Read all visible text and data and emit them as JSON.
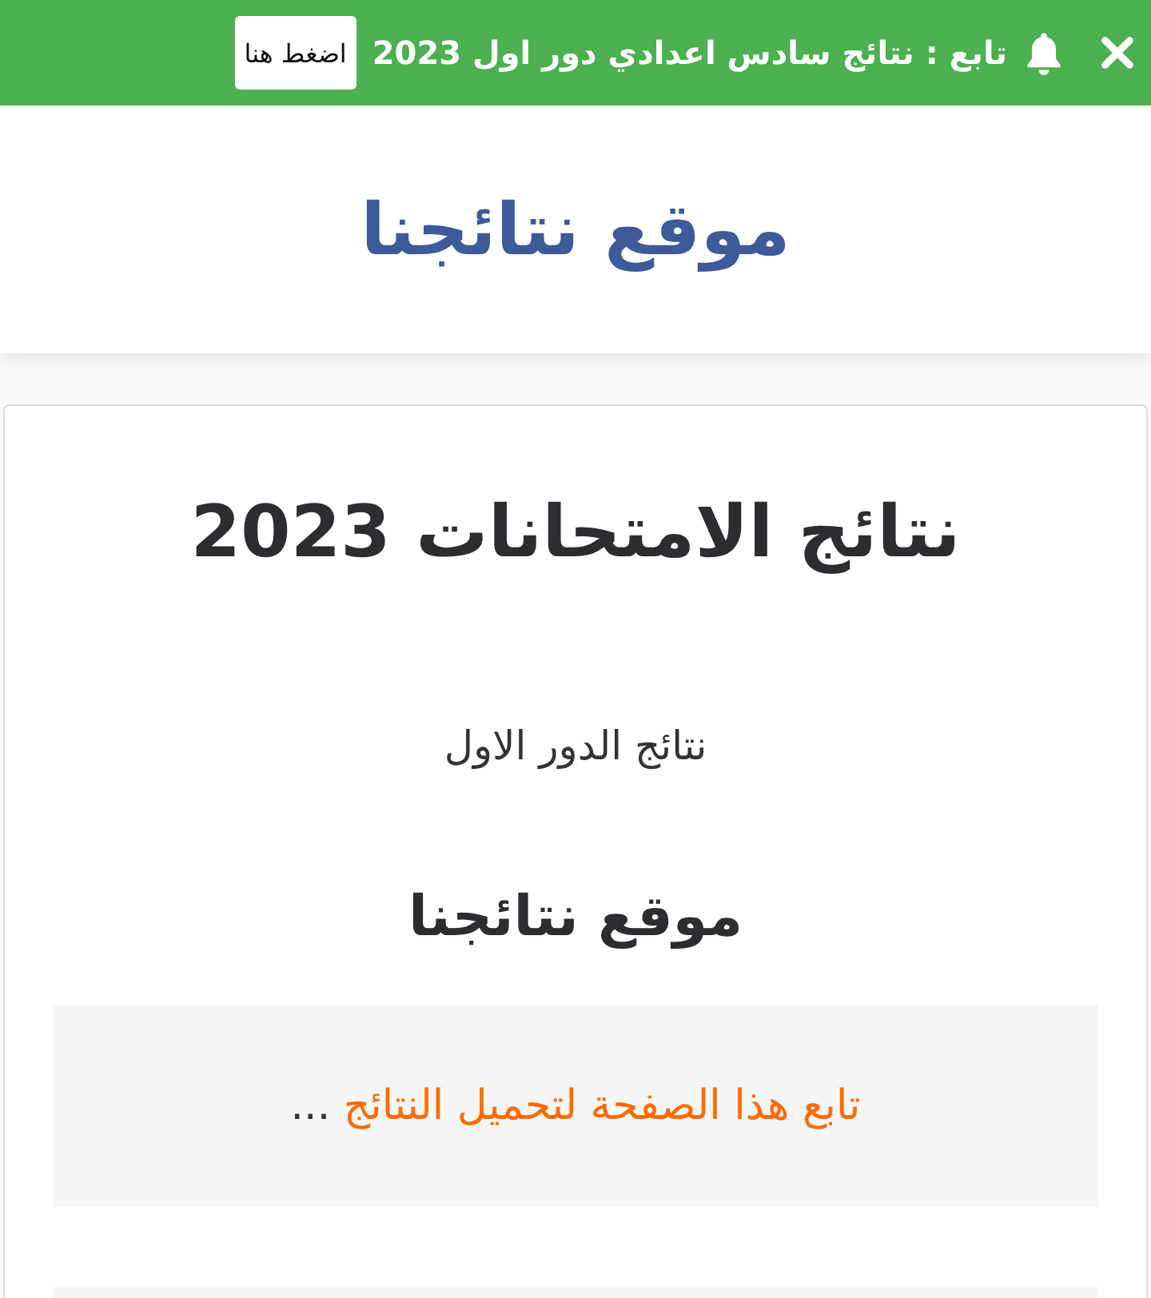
{
  "notification_bar": {
    "message": "تابع : نتائج سادس اعدادي دور اول 2023",
    "button": "اضغط هنا"
  },
  "header": {
    "site_title": "موقع نتائجنا"
  },
  "card": {
    "heading": "نتائج الامتحانات 2023",
    "subheading": "نتائج الدور الاول",
    "section_title": "موقع نتائجنا",
    "notice": {
      "link": "تابع هذا الصفحة لتحميل النتائج",
      "suffix": "..."
    }
  }
}
